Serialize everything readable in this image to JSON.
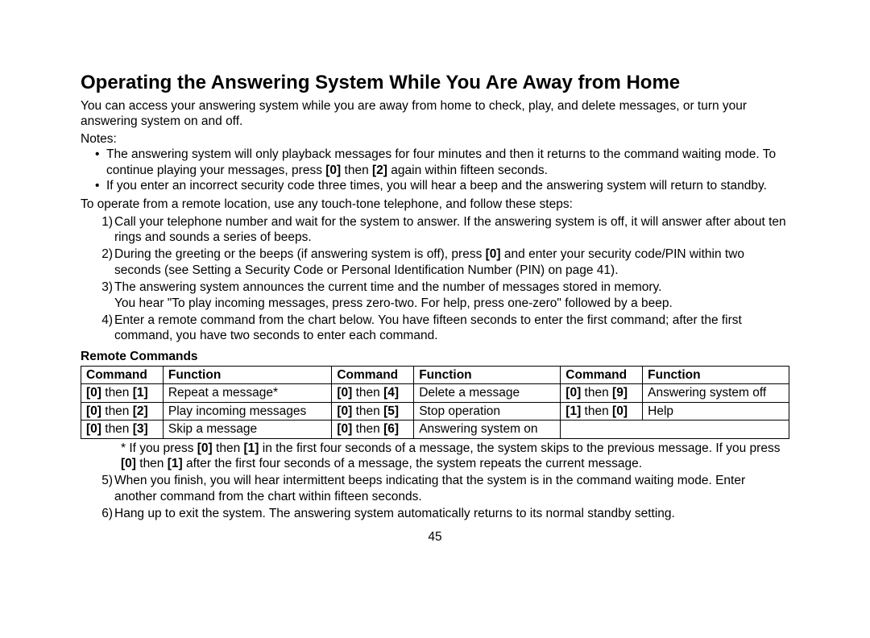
{
  "title": "Operating the Answering System While You Are Away from Home",
  "intro": "You can access your answering system while you are away from home to check, play, and delete messages, or turn your answering system on and off.",
  "notes_label": "Notes:",
  "notes": [
    {
      "pre": "The answering system will only playback messages for four minutes and then it returns to the command waiting mode. To continue playing your messages, press ",
      "k1": "[0]",
      "mid": " then ",
      "k2": "[2]",
      "post": " again within fifteen seconds."
    },
    {
      "text": "If you enter an incorrect security code three times, you will hear a beep and the answering system will return to standby."
    }
  ],
  "lead": "To operate from a remote location, use any touch-tone telephone, and follow these steps:",
  "steps": {
    "s1": "Call your telephone number and wait for the system to answer. If the answering system is off, it will answer after about ten rings and sounds a series of beeps.",
    "s2a": "During the greeting or the beeps (if answering system is off), press ",
    "s2k": "[0]",
    "s2b": " and enter your security code/PIN within two seconds (see Setting a Security Code or Personal Identification Number (PIN) on page 41).",
    "s3a": "The answering system announces the current time and the number of messages stored in memory.",
    "s3b": "You hear \"To play incoming messages, press zero-two. For help, press one-zero\" followed by a beep.",
    "s4": "Enter a remote command from the chart below. You have fifteen seconds to enter the first command; after the first command, you have two seconds to enter each command.",
    "s5": "When you finish, you will hear intermittent beeps indicating that the system is in the command waiting mode. Enter another command from the chart within fifteen seconds.",
    "s6": "Hang up to exit the system. The answering system automatically returns to its normal standby setting."
  },
  "table_title": "Remote Commands",
  "headers": {
    "cmd": "Command",
    "fn": "Function"
  },
  "rows": [
    [
      {
        "k1": "[0]",
        "mid": " then ",
        "k2": "[1]",
        "fn": "Repeat a message*"
      },
      {
        "k1": "[0]",
        "mid": " then ",
        "k2": "[4]",
        "fn": "Delete a message"
      },
      {
        "k1": "[0]",
        "mid": " then ",
        "k2": "[9]",
        "fn": "Answering system off"
      }
    ],
    [
      {
        "k1": "[0]",
        "mid": " then ",
        "k2": "[2]",
        "fn": "Play incoming messages"
      },
      {
        "k1": "[0]",
        "mid": " then ",
        "k2": "[5]",
        "fn": "Stop operation"
      },
      {
        "k1": "[1]",
        "mid": " then ",
        "k2": "[0]",
        "fn": "Help"
      }
    ],
    [
      {
        "k1": "[0]",
        "mid": " then ",
        "k2": "[3]",
        "fn": "Skip a message"
      },
      {
        "k1": "[0]",
        "mid": " then ",
        "k2": "[6]",
        "fn": "Answering system on"
      },
      null
    ]
  ],
  "footnote": {
    "a": "* If you press ",
    "k1": "[0]",
    "mid1": " then ",
    "k2": "[1]",
    "b": " in the first four seconds of a message, the system skips to the previous message. If you press ",
    "k3": "[0]",
    "mid2": " then ",
    "k4": "[1]",
    "c": " after the first four seconds of a message, the system repeats the current message."
  },
  "page": "45"
}
